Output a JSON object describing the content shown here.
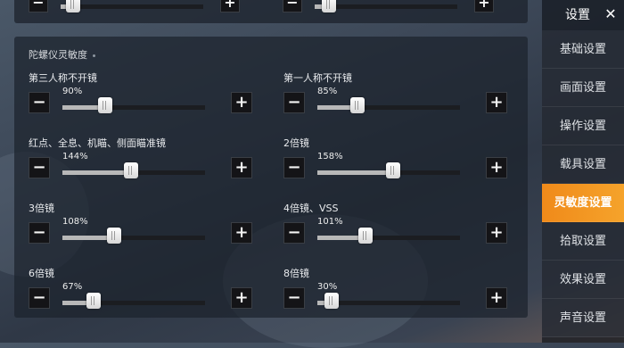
{
  "colors": {
    "accent": "#f39220",
    "panel": "#1c222c",
    "button": "#141417"
  },
  "top_row": [
    {
      "value_fraction": 0.08
    },
    {
      "value_fraction": 0.08
    }
  ],
  "gyro": {
    "title": "陀螺仪灵敏度",
    "rows": [
      {
        "label": "第三人称不开镜",
        "value": "90%",
        "fraction": 0.3
      },
      {
        "label": "第一人称不开镜",
        "value": "85%",
        "fraction": 0.28
      },
      {
        "label": "红点、全息、机瞄、侧面瞄准镜",
        "value": "144%",
        "fraction": 0.48
      },
      {
        "label": "2倍镜",
        "value": "158%",
        "fraction": 0.53
      },
      {
        "label": "3倍镜",
        "value": "108%",
        "fraction": 0.36
      },
      {
        "label": "4倍镜、VSS",
        "value": "101%",
        "fraction": 0.34
      },
      {
        "label": "6倍镜",
        "value": "67%",
        "fraction": 0.22
      },
      {
        "label": "8倍镜",
        "value": "30%",
        "fraction": 0.1
      }
    ]
  },
  "sidebar": {
    "title": "设置",
    "close_icon": "close-icon",
    "items": [
      {
        "label": "基础设置"
      },
      {
        "label": "画面设置"
      },
      {
        "label": "操作设置"
      },
      {
        "label": "载具设置"
      },
      {
        "label": "灵敏度设置",
        "active": true
      },
      {
        "label": "拾取设置"
      },
      {
        "label": "效果设置"
      },
      {
        "label": "声音设置"
      }
    ]
  }
}
